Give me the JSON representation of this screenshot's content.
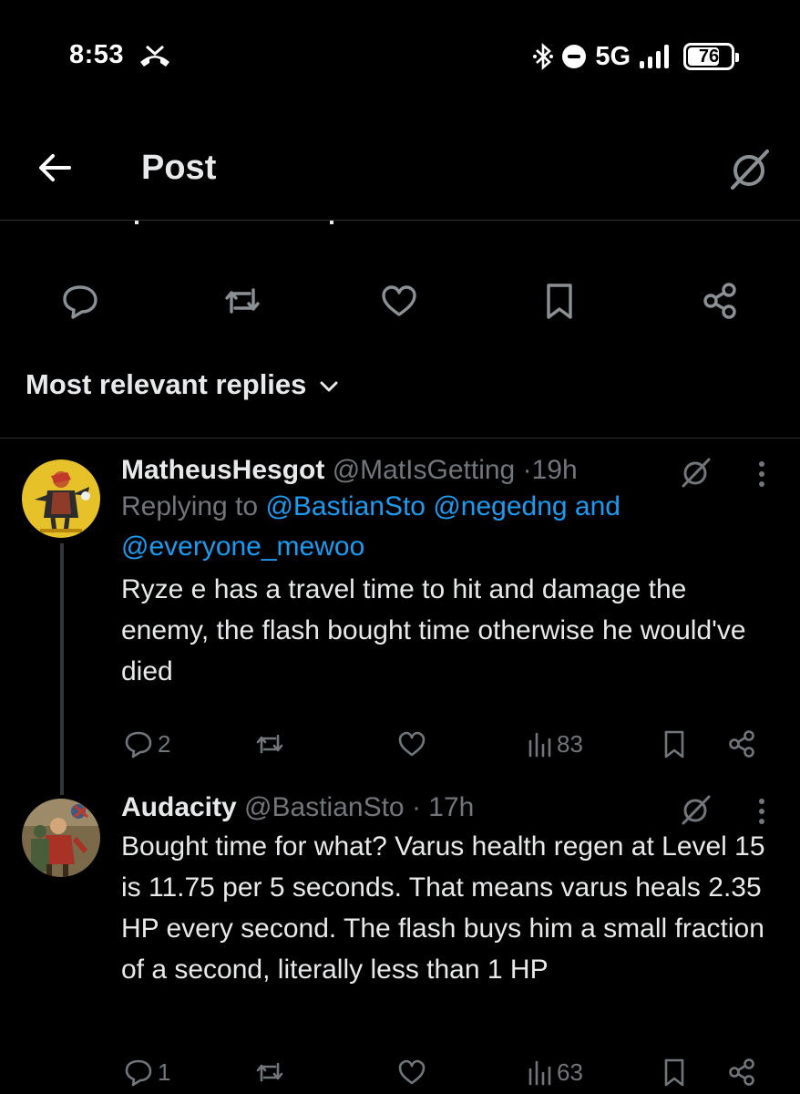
{
  "status_bar": {
    "time": "8:53",
    "network": "5G",
    "battery": "76",
    "battery_level": 0.76
  },
  "header": {
    "title": "Post"
  },
  "sort": {
    "label": "Most relevant replies"
  },
  "colors": {
    "background": "#000000",
    "text": "#e7e9ea",
    "muted": "#71767b",
    "link": "#1d9bf0",
    "divider": "#2f3336"
  },
  "replies": [
    {
      "name": "MatheusHesgot",
      "handle": "@MatIsGetting",
      "dot": "·",
      "time": "19h",
      "replying_prefix": "Replying to",
      "mention_1": "@BastianSto",
      "mention_2": "@negedng",
      "replying_and": "and",
      "mention_3": "@everyone_mewoo",
      "text": "Ryze e has a travel time to hit and damage the enemy, the flash bought time otherwise he would've died",
      "reply_count": "2",
      "views": "83"
    },
    {
      "name": "Audacity",
      "handle": "@BastianSto",
      "dot": "·",
      "time": "17h",
      "text": "Bought time for what? Varus health regen at Level 15 is 11.75 per 5 seconds. That means varus heals 2.35 HP every second. The flash buys him a small fraction of a second, literally less than 1 HP",
      "reply_count": "1",
      "views": "63"
    }
  ]
}
